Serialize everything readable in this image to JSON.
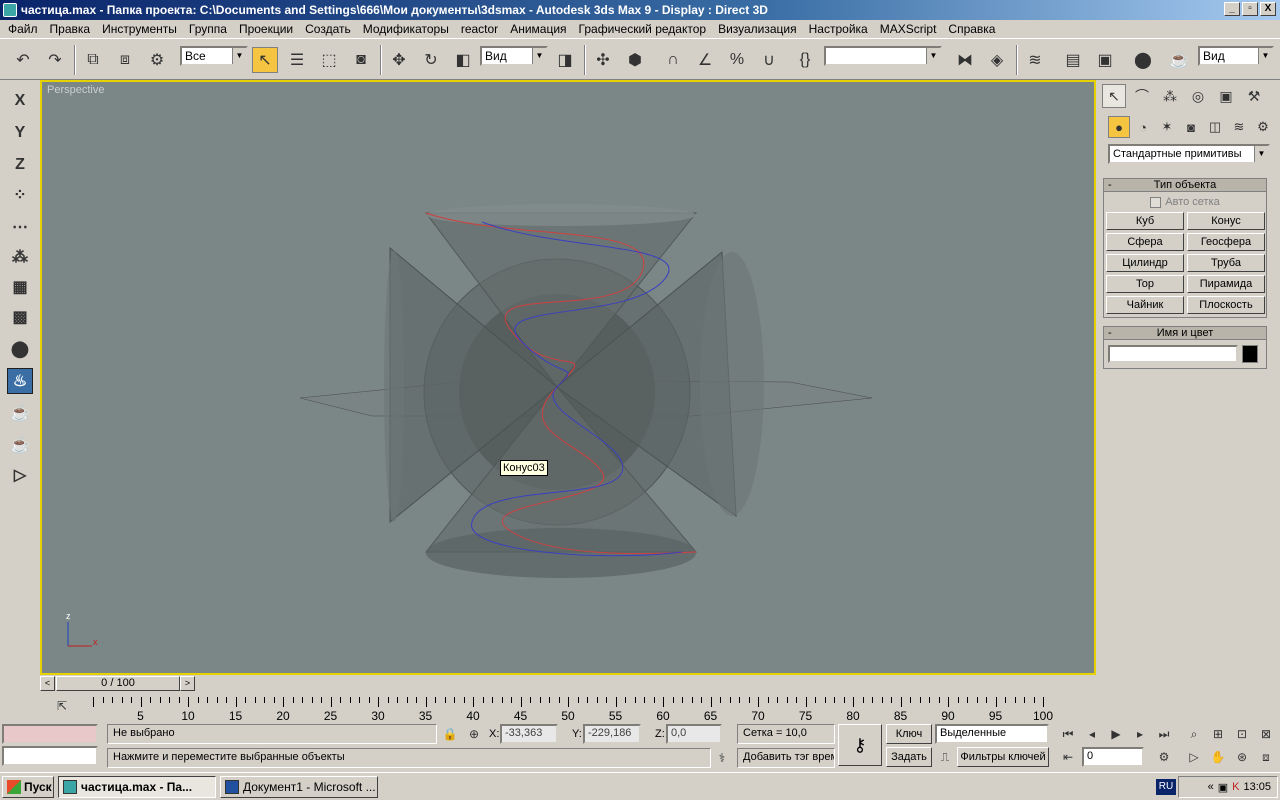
{
  "window": {
    "title": "частица.max    - Папка проекта: C:\\Documents and Settings\\666\\Мои документы\\3dsmax    - Autodesk 3ds Max 9     - Display : Direct 3D",
    "buttons": [
      "_",
      "▫",
      "X"
    ]
  },
  "menu": [
    "Файл",
    "Правка",
    "Инструменты",
    "Группа",
    "Проекции",
    "Создать",
    "Модификаторы",
    "reactor",
    "Анимация",
    "Графический редактор",
    "Визуализация",
    "Настройка",
    "MAXScript",
    "Справка"
  ],
  "toolbar": {
    "selection_filter": "Все",
    "ref_coord": "Вид",
    "named_sel": "",
    "render_view": "Вид",
    "icons": [
      "undo-icon",
      "redo-icon",
      "link-icon",
      "unlink-icon",
      "bind-space-warp-icon",
      "select-icon",
      "select-by-name-icon",
      "rect-region-icon",
      "window-crossing-icon",
      "move-icon",
      "rotate-icon",
      "scale-icon",
      "mirror-icon",
      "align-icon",
      "layers-icon",
      "curve-editor-icon",
      "schematic-icon",
      "material-editor-icon",
      "render-icon"
    ]
  },
  "left_toolbar": [
    "X",
    "Y",
    "Z"
  ],
  "viewport": {
    "label": "Perspective",
    "tooltip": "Конус03",
    "axis_z": "z",
    "axis_x": "x"
  },
  "command_panel": {
    "category": "Стандартные примитивы",
    "object_type": {
      "header": "Тип объекта",
      "autogrid": "Авто сетка",
      "buttons": [
        "Куб",
        "Конус",
        "Сфера",
        "Геосфера",
        "Цилиндр",
        "Труба",
        "Тор",
        "Пирамида",
        "Чайник",
        "Плоскость"
      ]
    },
    "name_color": {
      "header": "Имя и цвет",
      "name": "",
      "color": "#000000"
    }
  },
  "time": {
    "slider": "0 / 100",
    "ticks": [
      "5",
      "10",
      "15",
      "20",
      "25",
      "30",
      "35",
      "40",
      "45",
      "50",
      "55",
      "60",
      "65",
      "70",
      "75",
      "80",
      "85",
      "90",
      "95",
      "100"
    ]
  },
  "status": {
    "selection": "Не выбрано",
    "prompt": "Нажмите и переместите выбранные объекты",
    "x_label": "X:",
    "x": "-33,363",
    "y_label": "Y:",
    "y": "-229,186",
    "z_label": "Z:",
    "z": "0,0",
    "grid": "Сетка = 10,0",
    "add_tag": "Добавить тэг врем",
    "key_btn": "Ключ",
    "set_btn": "Задать",
    "key_mode": "Выделенные",
    "key_filters": "Фильтры ключей",
    "frame": "0"
  },
  "taskbar": {
    "start": "Пуск",
    "tasks": [
      "частица.max      - Па...",
      "Документ1 - Microsoft ..."
    ],
    "lang": "RU",
    "clock": "13:05"
  }
}
